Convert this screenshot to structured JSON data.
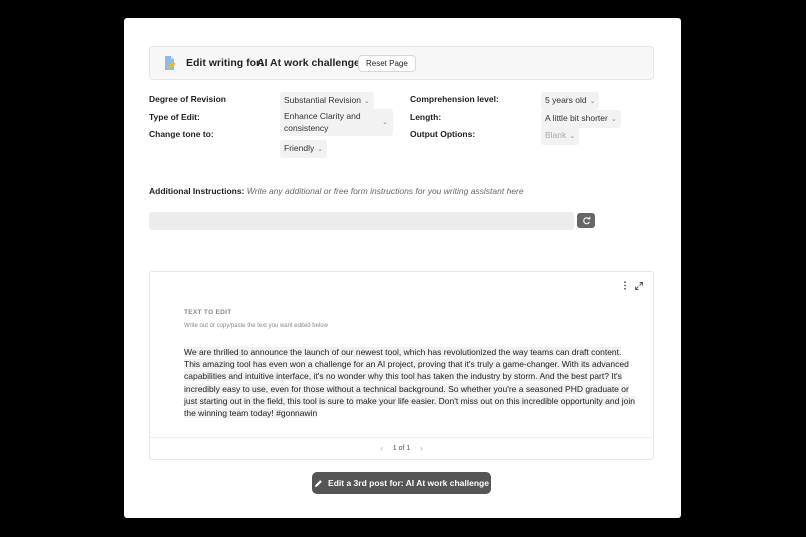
{
  "header": {
    "title": "Edit writing for:",
    "project": "AI At work challenge",
    "reset_label": "Reset Page"
  },
  "options": {
    "degree_label": "Degree of Revision",
    "degree_value": "Substantial Revision",
    "type_label": "Type of Edit:",
    "type_value": "Enhance Clarity and consistency",
    "tone_label": "Change tone to:",
    "tone_value": "Friendly",
    "comprehension_label": "Comprehension level:",
    "comprehension_value": "5 years old",
    "length_label": "Length:",
    "length_value": "A little bit shorter",
    "output_label": "Output Options:",
    "output_value": "Blank"
  },
  "instructions": {
    "label": "Additional Instructions:",
    "hint": "Write any additional or free form instructions for you writing assistant here",
    "value": ""
  },
  "editor": {
    "label": "TEXT TO EDIT",
    "hint": "Write out or copy/paste the text you want edited below",
    "text": "We are thrilled to announce the launch of our newest tool, which has revolutionized the way teams can draft content. This amazing tool has even won a challenge for an AI project, proving that it's truly a game-changer. With its advanced capabilities and intuitive interface, it's no wonder why this tool has taken the industry by storm. And the best part? It's incredibly easy to use, even for those without a technical background. So whether you're a seasoned PHD graduate or just starting out in the field, this tool is sure to make your life easier. Don't miss out on this incredible opportunity and join the winning team today! #gonnawin",
    "pagination": "1 of 1"
  },
  "action": {
    "label": "Edit a 3rd post for: AI At work challenge"
  },
  "icons": {
    "doc": "document-pencil-icon",
    "chevron": "chevron-down-icon",
    "refresh": "refresh-icon",
    "more": "more-vertical-icon",
    "expand": "expand-icon",
    "pencil": "pencil-icon"
  },
  "colors": {
    "accent_icon": "#5b9bd5",
    "button_dark": "#555555"
  }
}
